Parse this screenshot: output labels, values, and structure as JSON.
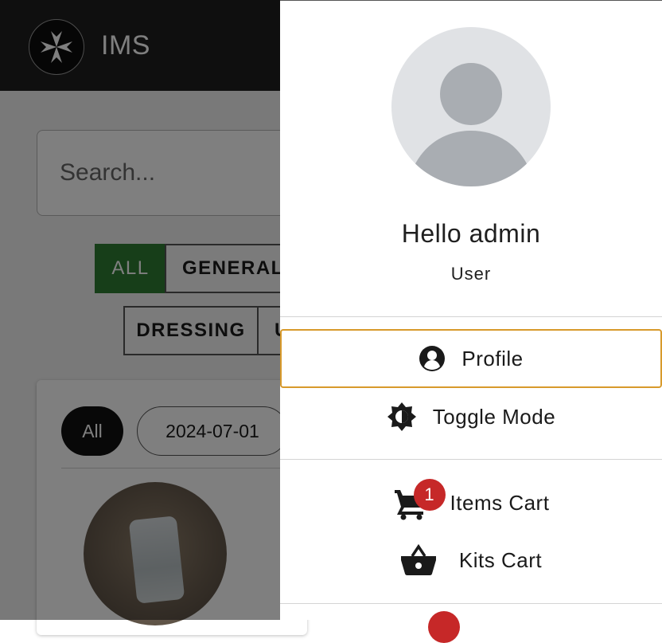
{
  "app": {
    "title": "IMS",
    "search_placeholder": "Search...",
    "category_row_1": [
      "ALL",
      "GENERAL"
    ],
    "category_row_2": [
      "DRESSING",
      "U"
    ],
    "date_chips": [
      "All",
      "2024-07-01"
    ],
    "accent_color": "#2e7d32"
  },
  "drawer": {
    "greeting": "Hello admin",
    "role": "User",
    "menu": {
      "profile": "Profile",
      "toggle_mode": "Toggle Mode",
      "items_cart": "Items Cart",
      "items_cart_badge": "1",
      "kits_cart": "Kits Cart"
    },
    "focus_color": "#d89a2b",
    "badge_color": "#c62828"
  },
  "icons": [
    "maltese-cross-logo",
    "account-circle-icon",
    "brightness-icon",
    "shopping-cart-icon",
    "shopping-basket-icon"
  ]
}
